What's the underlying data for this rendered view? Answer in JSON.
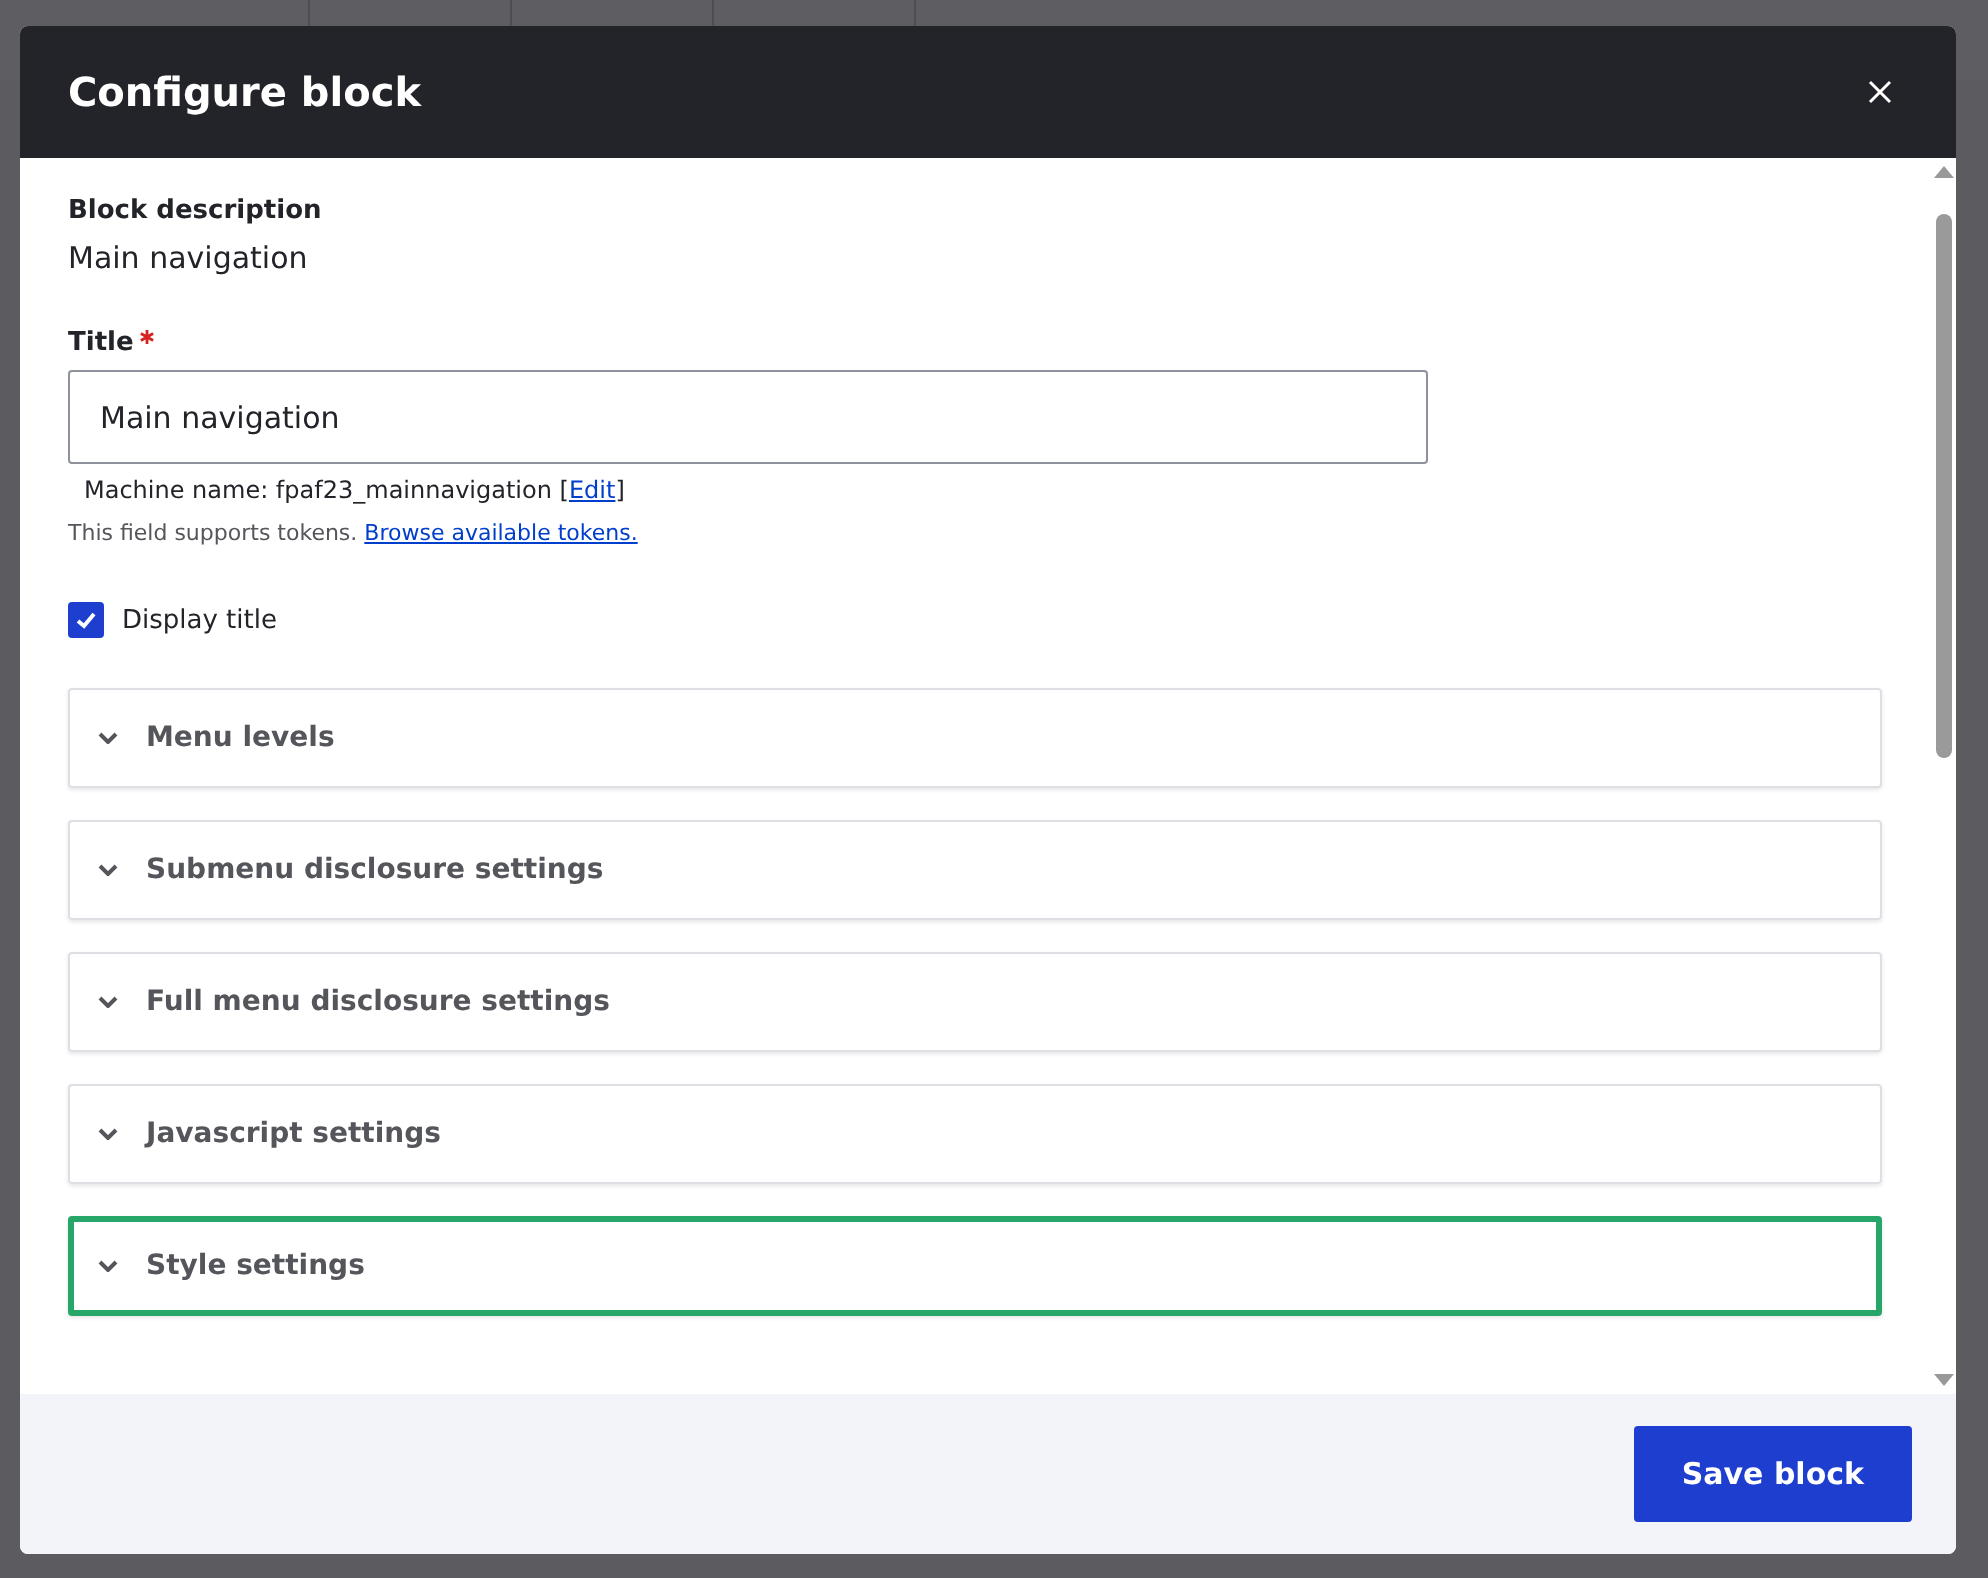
{
  "dialog": {
    "title": "Configure block",
    "block_description": {
      "label": "Block description",
      "value": "Main navigation"
    },
    "title_field": {
      "label": "Title",
      "required": true,
      "value": "Main navigation",
      "machine_name": "Machine name: fpaf23_mainnavigation [",
      "machine_edit": "Edit",
      "machine_close": "]",
      "help": "This field supports tokens.",
      "help_link": "Browse available tokens."
    },
    "display_title": {
      "label": "Display title",
      "checked": true
    },
    "sections": [
      {
        "label": "Menu levels",
        "focused": false
      },
      {
        "label": "Submenu disclosure settings",
        "focused": false
      },
      {
        "label": "Full menu disclosure settings",
        "focused": false
      },
      {
        "label": "Javascript settings",
        "focused": false
      },
      {
        "label": "Style settings",
        "focused": true
      }
    ],
    "buttons": [
      "Save block"
    ]
  }
}
